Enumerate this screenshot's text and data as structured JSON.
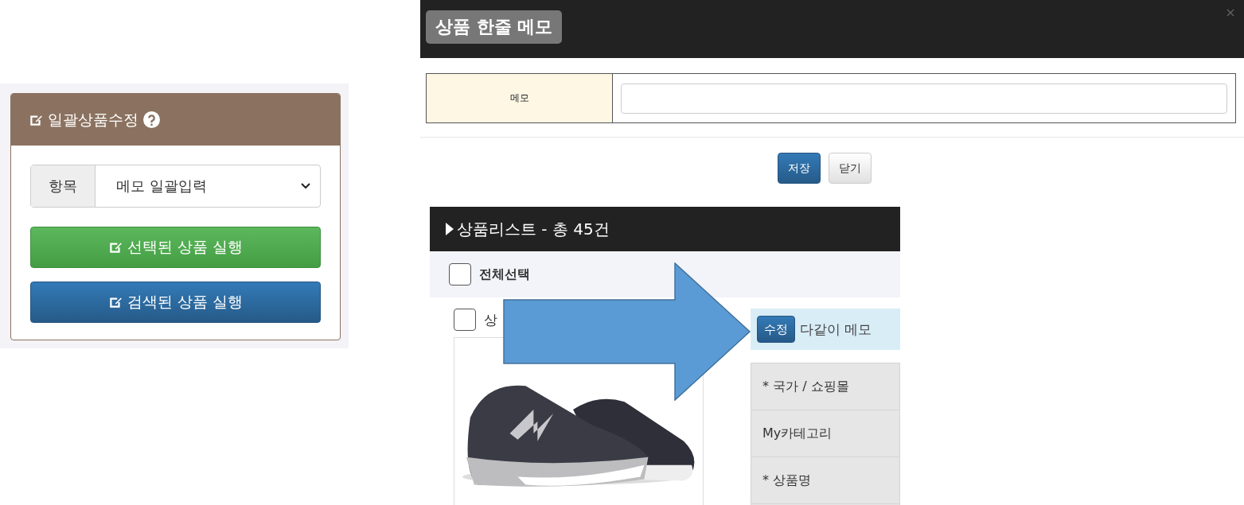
{
  "bulk_edit_panel": {
    "title": "일괄상품수정",
    "item_label": "항목",
    "item_select": {
      "value": "메모 일괄입력"
    },
    "buttons": [
      {
        "label": "선택된 상품 실행",
        "kind": "success"
      },
      {
        "label": "검색된 상품 실행",
        "kind": "primary"
      }
    ]
  },
  "memo_dialog": {
    "title": "상품 한줄 메모",
    "field_label": "메모",
    "buttons": [
      {
        "label": "저장",
        "kind": "primary"
      },
      {
        "label": "닫기",
        "kind": "default"
      }
    ]
  },
  "product_list": {
    "title": "상품리스트 - 총 45건",
    "select_all": {
      "label": "전체선택",
      "checked": false
    },
    "product": {
      "checked": false,
      "label": "상",
      "edit_button": "수정",
      "memo_label": "다같이 메모",
      "fields": [
        "* 국가 / 쇼핑몰",
        "My카테고리",
        "* 상품명"
      ]
    }
  }
}
